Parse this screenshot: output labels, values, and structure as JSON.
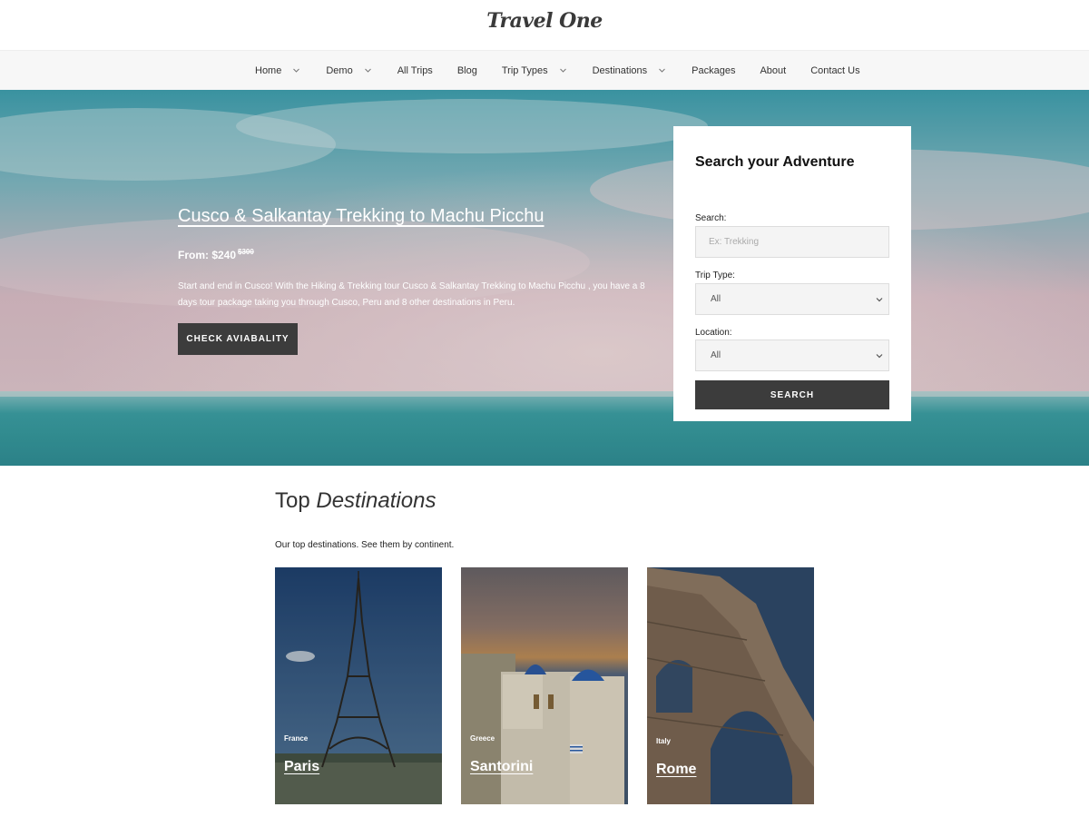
{
  "site": {
    "logo": "Travel One"
  },
  "nav": {
    "items": [
      {
        "label": "Home",
        "has_dropdown": true
      },
      {
        "label": "Demo",
        "has_dropdown": true
      },
      {
        "label": "All Trips",
        "has_dropdown": false
      },
      {
        "label": "Blog",
        "has_dropdown": false
      },
      {
        "label": "Trip Types",
        "has_dropdown": true
      },
      {
        "label": "Destinations",
        "has_dropdown": true
      },
      {
        "label": "Packages",
        "has_dropdown": false
      },
      {
        "label": "About",
        "has_dropdown": false
      },
      {
        "label": "Contact Us",
        "has_dropdown": false
      }
    ]
  },
  "hero": {
    "title": "Cusco & Salkantay Trekking to Machu Picchu",
    "price_prefix": "From: $240",
    "old_price": "$300",
    "description": "Start and end in Cusco! With the Hiking & Trekking tour Cusco & Salkantay Trekking to Machu Picchu , you have a 8 days tour package taking you through Cusco, Peru and 8 other destinations in Peru.",
    "cta_label": "CHECK AVIABALITY"
  },
  "search_panel": {
    "title": "Search your Adventure",
    "search_label": "Search:",
    "search_placeholder": "Ex: Trekking",
    "trip_type_label": "Trip Type:",
    "trip_type_value": "All",
    "location_label": "Location:",
    "location_value": "All",
    "button_label": "SEARCH"
  },
  "destinations": {
    "title_plain": "Top",
    "title_italic": "Destinations",
    "description": "Our top destinations. See them by continent.",
    "cards": [
      {
        "country": "France",
        "city": "Paris"
      },
      {
        "country": "Greece",
        "city": "Santorini"
      },
      {
        "country": "Italy",
        "city": "Rome"
      }
    ]
  },
  "colors": {
    "button_dark": "#3c3c3c",
    "nav_bg": "#f7f7f7",
    "sea": "#3a9a9f",
    "sky_pink": "#d9bcc4"
  }
}
